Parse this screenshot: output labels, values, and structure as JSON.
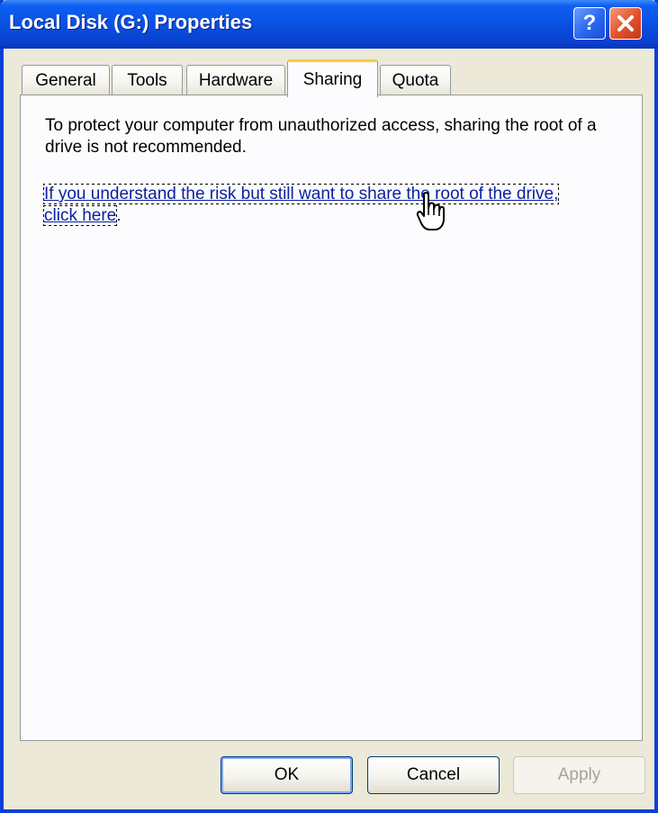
{
  "window": {
    "title": "Local Disk (G:) Properties"
  },
  "titlebar": {
    "help_icon": "question-mark-icon",
    "close_icon": "close-x-icon"
  },
  "tabs": [
    {
      "label": "General",
      "active": false
    },
    {
      "label": "Tools",
      "active": false
    },
    {
      "label": "Hardware",
      "active": false
    },
    {
      "label": "Sharing",
      "active": true
    },
    {
      "label": "Quota",
      "active": false
    }
  ],
  "sharing": {
    "info_text": "To protect your computer from unauthorized access, sharing the root of a drive is not recommended.",
    "link_text": "If you understand the risk but still want to share the root of the drive, click here",
    "link_suffix": "."
  },
  "buttons": {
    "ok": "OK",
    "cancel": "Cancel",
    "apply": "Apply"
  },
  "colors": {
    "titlebar": "#0a55e8",
    "link": "#0a1ea0",
    "active_tab_accent": "#ffc83c",
    "dialog_bg": "#ece9d8"
  }
}
